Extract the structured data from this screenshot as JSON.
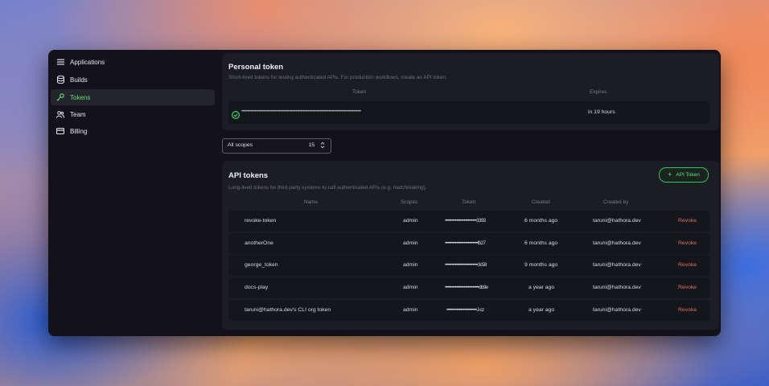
{
  "sidebar": {
    "items": [
      {
        "label": "Applications",
        "icon": "menu-icon",
        "active": false
      },
      {
        "label": "Builds",
        "icon": "database-icon",
        "active": false
      },
      {
        "label": "Tokens",
        "icon": "key-icon",
        "active": true
      },
      {
        "label": "Team",
        "icon": "users-icon",
        "active": false
      },
      {
        "label": "Billing",
        "icon": "credit-card-icon",
        "active": false
      }
    ]
  },
  "personal": {
    "title": "Personal token",
    "subtitle": "Short-lived tokens for testing authenticated APIs. For production workflows, create an API token.",
    "col_token": "Token",
    "col_expires": "Expires",
    "token_value": "•••••••••••••••••••••••••••••••••••••••••••••••••••••••••••••••••••••••••••••••••••••••••••••••••••",
    "expires": "in 19 hours"
  },
  "filter": {
    "scope_label": "All scopes",
    "scope_count": "15"
  },
  "api_tokens": {
    "title": "API tokens",
    "subtitle": "Long-lived tokens for third party systems to call authenticated APIs (e.g. matchmaking).",
    "add_button": "API Token",
    "columns": {
      "name": "Name",
      "scopes": "Scopes",
      "token": "Token",
      "created": "Created",
      "created_by": "Created by"
    },
    "revoke_label": "Revoke",
    "rows": [
      {
        "name": "revoke-token",
        "scopes": "admin",
        "token": "•••••••••••••••••••••••••3393",
        "created": "6 months ago",
        "created_by": "taruni@hathora.dev"
      },
      {
        "name": "anotherOne",
        "scopes": "admin",
        "token": "••••••••••••••••••••••••••fb27",
        "created": "6 months ago",
        "created_by": "taruni@hathora.dev"
      },
      {
        "name": "george_token",
        "scopes": "admin",
        "token": "••••••••••••••••••••••••••3c58",
        "created": "9 months ago",
        "created_by": "taruni@hathora.dev"
      },
      {
        "name": "docs-play",
        "scopes": "admin",
        "token": "•••••••••••••••••••••••••••db9e",
        "created": "a year ago",
        "created_by": "taruni@hathora.dev"
      },
      {
        "name": "taruni@hathora.dev's CLI org token",
        "scopes": "admin",
        "token": "••••••••••••••••••••••••J-cz",
        "created": "a year ago",
        "created_by": "taruni@hathora.dev"
      }
    ]
  }
}
